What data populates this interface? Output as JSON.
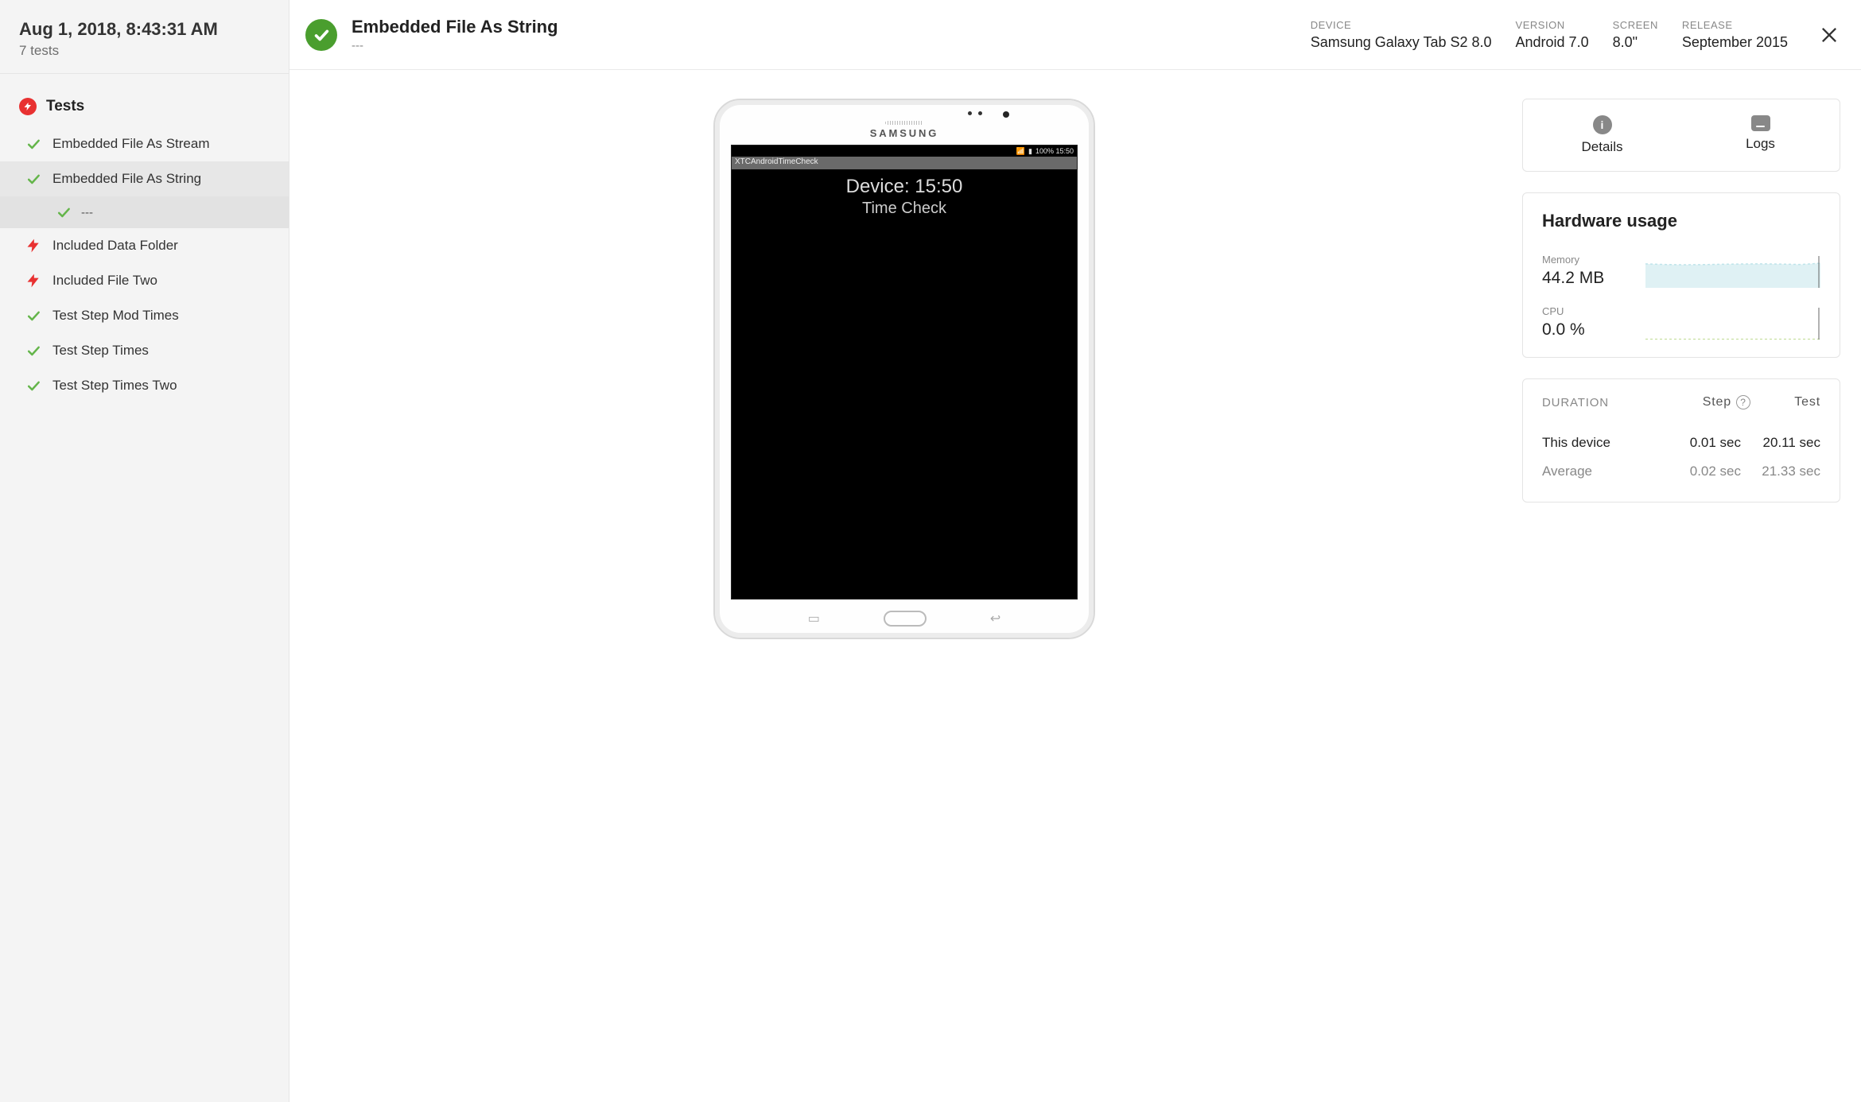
{
  "sidebar": {
    "timestamp": "Aug 1, 2018, 8:43:31 AM",
    "subtitle": "7 tests",
    "tests_heading": "Tests",
    "items": [
      {
        "label": "Embedded File As Stream",
        "status": "pass"
      },
      {
        "label": "Embedded File As String",
        "status": "pass",
        "selected": true,
        "substeps": [
          {
            "label": "---",
            "status": "pass"
          }
        ]
      },
      {
        "label": "Included Data Folder",
        "status": "fail"
      },
      {
        "label": "Included File Two",
        "status": "fail"
      },
      {
        "label": "Test Step Mod Times",
        "status": "pass"
      },
      {
        "label": "Test Step Times",
        "status": "pass"
      },
      {
        "label": "Test Step Times Two",
        "status": "pass"
      }
    ]
  },
  "topbar": {
    "title": "Embedded File As String",
    "subtitle": "---",
    "meta": {
      "device_label": "DEVICE",
      "device_value": "Samsung Galaxy Tab S2 8.0",
      "version_label": "VERSION",
      "version_value": "Android 7.0",
      "screen_label": "SCREEN",
      "screen_value": "8.0\"",
      "release_label": "RELEASE",
      "release_value": "September 2015"
    }
  },
  "device_screen": {
    "brand": "SAMSUNG",
    "status_right": "100%  15:50",
    "app_bar": "XTCAndroidTimeCheck",
    "line1": "Device: 15:50",
    "line2": "Time Check"
  },
  "tabs": {
    "details": "Details",
    "logs": "Logs"
  },
  "hardware": {
    "heading": "Hardware usage",
    "memory_label": "Memory",
    "memory_value": "44.2 MB",
    "cpu_label": "CPU",
    "cpu_value": "0.0 %"
  },
  "duration": {
    "header_label": "DURATION",
    "col_step": "Step",
    "col_test": "Test",
    "rows": [
      {
        "name": "This device",
        "step": "0.01 sec",
        "test": "20.11 sec",
        "avg": false
      },
      {
        "name": "Average",
        "step": "0.02 sec",
        "test": "21.33 sec",
        "avg": true
      }
    ]
  },
  "chart_data": [
    {
      "type": "area",
      "title": "Memory",
      "ylabel": "MB",
      "x": [
        0,
        1,
        2,
        3,
        4,
        5,
        6,
        7,
        8,
        9
      ],
      "values": [
        45.2,
        44.0,
        43.5,
        43.8,
        44.5,
        45.0,
        45.2,
        44.8,
        44.0,
        46.5
      ],
      "ylim": [
        0,
        60
      ],
      "color": "#bfe4ea"
    },
    {
      "type": "line",
      "title": "CPU",
      "ylabel": "%",
      "x": [
        0,
        1,
        2,
        3,
        4,
        5,
        6,
        7,
        8,
        9
      ],
      "values": [
        0,
        0,
        0,
        0,
        0,
        0,
        0,
        0,
        0,
        0
      ],
      "ylim": [
        0,
        100
      ],
      "color": "#a9cf6f"
    }
  ]
}
